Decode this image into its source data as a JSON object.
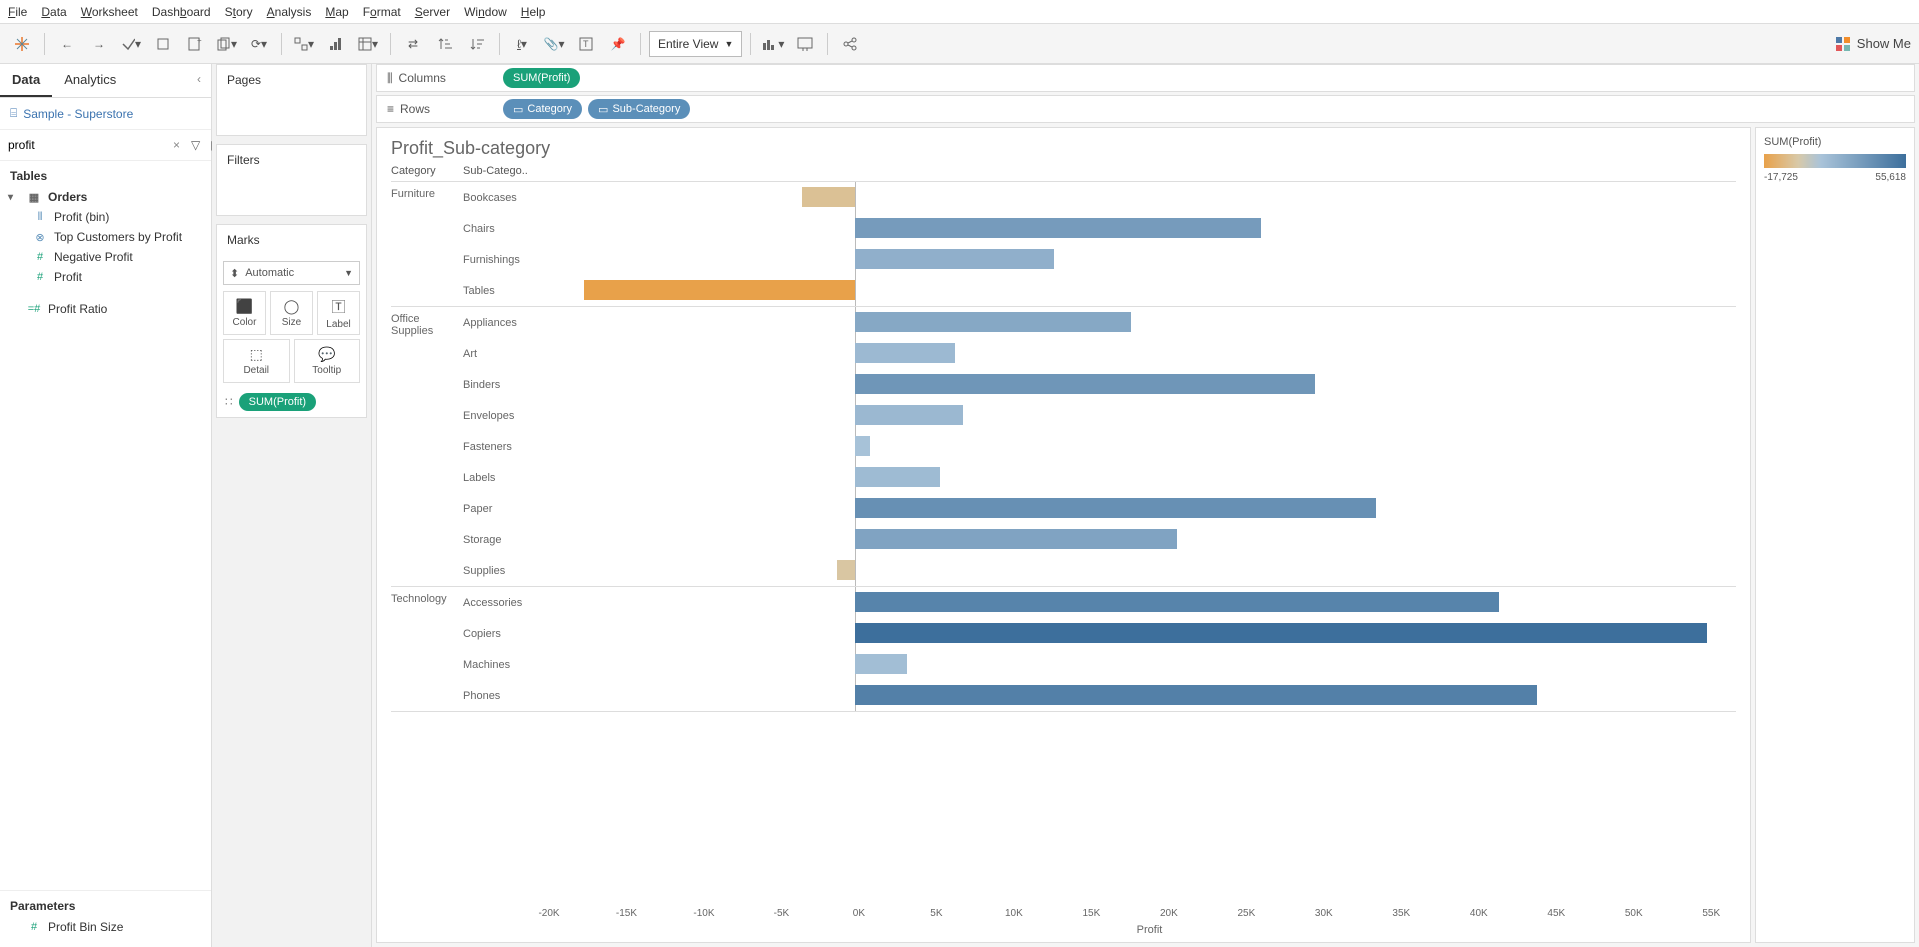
{
  "menu": [
    "File",
    "Data",
    "Worksheet",
    "Dashboard",
    "Story",
    "Analysis",
    "Map",
    "Format",
    "Server",
    "Window",
    "Help"
  ],
  "toolbar": {
    "fit": "Entire View",
    "showme": "Show Me"
  },
  "left": {
    "tabs": [
      "Data",
      "Analytics"
    ],
    "datasource": "Sample - Superstore",
    "search": "profit",
    "tables_hdr": "Tables",
    "orders": "Orders",
    "fields": [
      {
        "icon": "bar",
        "label": "Profit (bin)"
      },
      {
        "icon": "set",
        "label": "Top Customers by Profit"
      },
      {
        "icon": "hash",
        "label": "Negative Profit"
      },
      {
        "icon": "hash",
        "label": "Profit"
      }
    ],
    "loose_field": {
      "icon": "hash",
      "label": "Profit Ratio"
    },
    "params_hdr": "Parameters",
    "params": [
      {
        "icon": "hash",
        "label": "Profit Bin Size"
      }
    ]
  },
  "mid": {
    "pages": "Pages",
    "filters": "Filters",
    "marks": "Marks",
    "mark_type": "Automatic",
    "cells": [
      "Color",
      "Size",
      "Label",
      "Detail",
      "Tooltip"
    ],
    "mark_pill": "SUM(Profit)"
  },
  "shelves": {
    "columns_label": "Columns",
    "columns_pill": "SUM(Profit)",
    "rows_label": "Rows",
    "rows_pills": [
      "Category",
      "Sub-Category"
    ]
  },
  "viz": {
    "title": "Profit_Sub-category",
    "col_headers": [
      "Category",
      "Sub-Catego.."
    ],
    "axis_label": "Profit",
    "axis_min": -20000,
    "axis_max": 57500,
    "ticks": [
      "-20K",
      "-15K",
      "-10K",
      "-5K",
      "0K",
      "5K",
      "10K",
      "15K",
      "20K",
      "25K",
      "30K",
      "35K",
      "40K",
      "45K",
      "50K",
      "55K"
    ]
  },
  "legend": {
    "title": "SUM(Profit)",
    "min": "-17,725",
    "max": "55,618"
  },
  "chart_data": {
    "type": "bar",
    "xlabel": "Profit",
    "xlim": [
      -20000,
      57500
    ],
    "color_scale": {
      "field": "SUM(Profit)",
      "min": -17725,
      "max": 55618,
      "low": "#e8a14a",
      "mid": "#d8c9a8",
      "high": "#3d6f9c"
    },
    "groups": [
      {
        "category": "Furniture",
        "rows": [
          {
            "sub": "Bookcases",
            "value": -3500
          },
          {
            "sub": "Chairs",
            "value": 26500
          },
          {
            "sub": "Furnishings",
            "value": 13000
          },
          {
            "sub": "Tables",
            "value": -17725
          }
        ]
      },
      {
        "category": "Office Supplies",
        "rows": [
          {
            "sub": "Appliances",
            "value": 18000
          },
          {
            "sub": "Art",
            "value": 6500
          },
          {
            "sub": "Binders",
            "value": 30000
          },
          {
            "sub": "Envelopes",
            "value": 7000
          },
          {
            "sub": "Fasteners",
            "value": 950
          },
          {
            "sub": "Labels",
            "value": 5500
          },
          {
            "sub": "Paper",
            "value": 34000
          },
          {
            "sub": "Storage",
            "value": 21000
          },
          {
            "sub": "Supplies",
            "value": -1200
          }
        ]
      },
      {
        "category": "Technology",
        "rows": [
          {
            "sub": "Accessories",
            "value": 42000
          },
          {
            "sub": "Copiers",
            "value": 55618
          },
          {
            "sub": "Machines",
            "value": 3400
          },
          {
            "sub": "Phones",
            "value": 44500
          }
        ]
      }
    ]
  }
}
